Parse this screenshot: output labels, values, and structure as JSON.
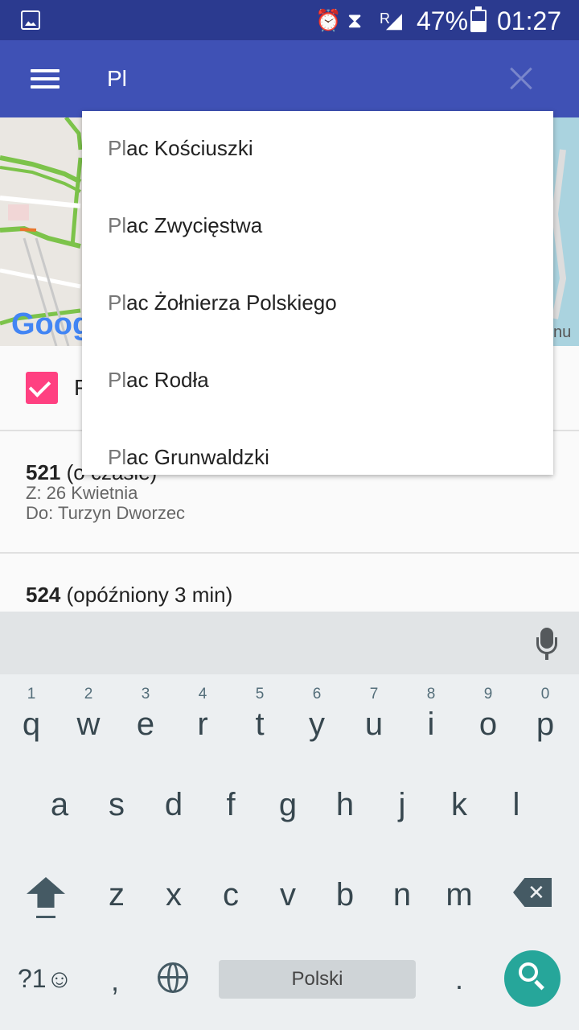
{
  "status_bar": {
    "battery": "47%",
    "time": "01:27",
    "signal_label": "R"
  },
  "app_bar": {
    "query": "Pl"
  },
  "map": {
    "logo_text": "Goog",
    "corner_text": "nu"
  },
  "filter": {
    "label": "P",
    "checked": true
  },
  "suggestions": [
    {
      "match": "Pl",
      "rest": "ac Kościuszki"
    },
    {
      "match": "Pl",
      "rest": "ac Zwycięstwa"
    },
    {
      "match": "Pl",
      "rest": "ac Żołnierza Polskiego"
    },
    {
      "match": "Pl",
      "rest": "ac Rodła"
    },
    {
      "match": "Pl",
      "rest": "ac Grunwaldzki"
    }
  ],
  "departures": [
    {
      "line": "521",
      "status": "(o czasie)",
      "from": "Z: 26 Kwietnia",
      "to": "Do: Turzyn Dworzec"
    },
    {
      "line": "524",
      "status": "(opóźniony 3 min)"
    }
  ],
  "keyboard": {
    "row1": [
      {
        "key": "q",
        "hint": "1"
      },
      {
        "key": "w",
        "hint": "2"
      },
      {
        "key": "e",
        "hint": "3"
      },
      {
        "key": "r",
        "hint": "4"
      },
      {
        "key": "t",
        "hint": "5"
      },
      {
        "key": "y",
        "hint": "6"
      },
      {
        "key": "u",
        "hint": "7"
      },
      {
        "key": "i",
        "hint": "8"
      },
      {
        "key": "o",
        "hint": "9"
      },
      {
        "key": "p",
        "hint": "0"
      }
    ],
    "row2": [
      "a",
      "s",
      "d",
      "f",
      "g",
      "h",
      "j",
      "k",
      "l"
    ],
    "row3": [
      "z",
      "x",
      "c",
      "v",
      "b",
      "n",
      "m"
    ],
    "symbols_label": "?1☺",
    "comma": ",",
    "space_label": "Polski",
    "period": "."
  },
  "colors": {
    "status_bar": "#2b3a8f",
    "app_bar": "#3f51b5",
    "checkbox": "#ff4081",
    "search_fab": "#26a69a"
  }
}
